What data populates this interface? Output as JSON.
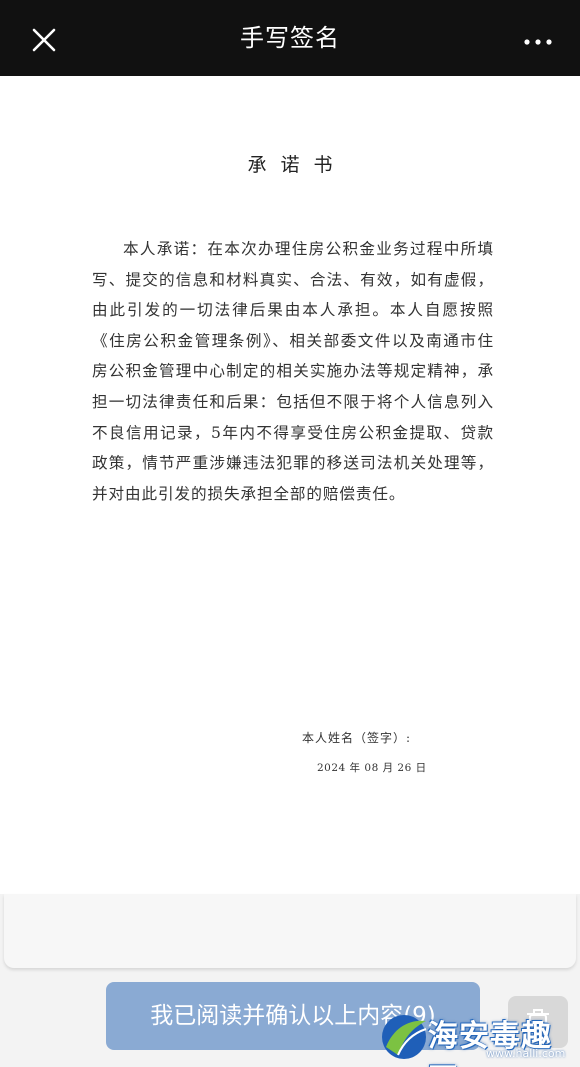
{
  "navbar": {
    "title": "手写签名",
    "close_icon": "close-icon",
    "more_icon": "more-horizontal-icon"
  },
  "document": {
    "title": "承诺书",
    "body": "本人承诺：在本次办理住房公积金业务过程中所填写、提交的信息和材料真实、合法、有效，如有虚假，由此引发的一切法律后果由本人承担。本人自愿按照《住房公积金管理条例》、相关部委文件以及南通市住房公积金管理中心制定的相关实施办法等规定精神，承担一切法律责任和后果：包括但不限于将个人信息列入不良信用记录，5年内不得享受住房公积金提取、贷款政策，情节严重涉嫌违法犯罪的移送司法机关处理等，并对由此引发的损失承担全部的赔偿责任。",
    "sign_label": "本人姓名（签字）:",
    "date": "2024 年 08 月 26 日"
  },
  "footer": {
    "confirm_label": "我已阅读并确认以上内容(9)",
    "watermark_text": "海安毒趣园",
    "watermark_url": "www.halli.com"
  },
  "colors": {
    "navbar_bg": "#111111",
    "confirm_bg": "#8aaad3",
    "page_bg": "#f3f3f3"
  }
}
